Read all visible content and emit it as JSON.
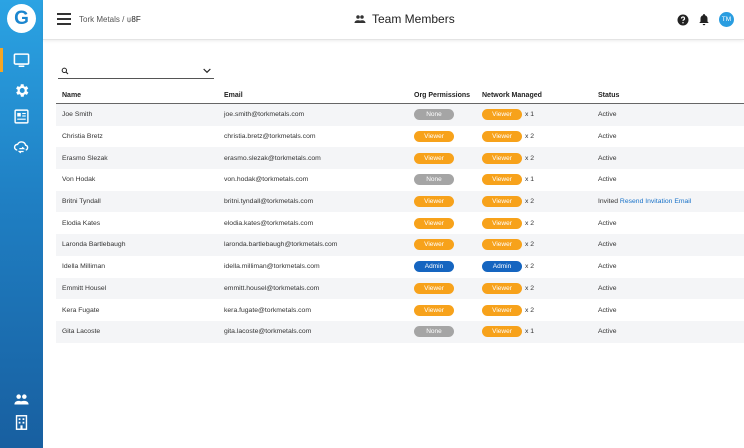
{
  "header": {
    "org": "Tork Metals /",
    "site": "8F",
    "title": "Team Members",
    "avatar": "TM"
  },
  "sidebar": {
    "logo": "G",
    "items": [
      "monitor-icon",
      "gear-icon",
      "report-icon",
      "cloud-sync-icon",
      "users-icon",
      "building-icon"
    ]
  },
  "search": {
    "value": "",
    "placeholder": ""
  },
  "table": {
    "columns": [
      "Name",
      "Email",
      "Org Permissions",
      "Network Managed",
      "Status"
    ],
    "rows": [
      {
        "name": "Joe Smith",
        "email": "joe.smith@torkmetals.com",
        "org": "None",
        "net": "Viewer",
        "count": "x 1",
        "status": "Active",
        "action": ""
      },
      {
        "name": "Christia Bretz",
        "email": "christia.bretz@torkmetals.com",
        "org": "Viewer",
        "net": "Viewer",
        "count": "x 2",
        "status": "Active",
        "action": ""
      },
      {
        "name": "Erasmo Slezak",
        "email": "erasmo.slezak@torkmetals.com",
        "org": "Viewer",
        "net": "Viewer",
        "count": "x 2",
        "status": "Active",
        "action": ""
      },
      {
        "name": "Von Hodak",
        "email": "von.hodak@torkmetals.com",
        "org": "None",
        "net": "Viewer",
        "count": "x 1",
        "status": "Active",
        "action": ""
      },
      {
        "name": "Britni Tyndall",
        "email": "britni.tyndall@torkmetals.com",
        "org": "Viewer",
        "net": "Viewer",
        "count": "x 2",
        "status": "Invited",
        "action": "Resend Invitation Email"
      },
      {
        "name": "Elodia Kates",
        "email": "elodia.kates@torkmetals.com",
        "org": "Viewer",
        "net": "Viewer",
        "count": "x 2",
        "status": "Active",
        "action": ""
      },
      {
        "name": "Laronda Bartlebaugh",
        "email": "laronda.bartlebaugh@torkmetals.com",
        "org": "Viewer",
        "net": "Viewer",
        "count": "x 2",
        "status": "Active",
        "action": ""
      },
      {
        "name": "Idella Milliman",
        "email": "idella.milliman@torkmetals.com",
        "org": "Admin",
        "net": "Admin",
        "count": "x 2",
        "status": "Active",
        "action": ""
      },
      {
        "name": "Emmitt Housel",
        "email": "emmitt.housel@torkmetals.com",
        "org": "Viewer",
        "net": "Viewer",
        "count": "x 2",
        "status": "Active",
        "action": ""
      },
      {
        "name": "Kera Fugate",
        "email": "kera.fugate@torkmetals.com",
        "org": "Viewer",
        "net": "Viewer",
        "count": "x 2",
        "status": "Active",
        "action": ""
      },
      {
        "name": "Gita Lacoste",
        "email": "gita.lacoste@torkmetals.com",
        "org": "None",
        "net": "Viewer",
        "count": "x 1",
        "status": "Active",
        "action": ""
      }
    ]
  },
  "colors": {
    "viewer": "#f7a21b",
    "none": "#a5a5a5",
    "admin": "#1565c0",
    "accent": "#2a9de0",
    "link": "#1a73c9"
  }
}
